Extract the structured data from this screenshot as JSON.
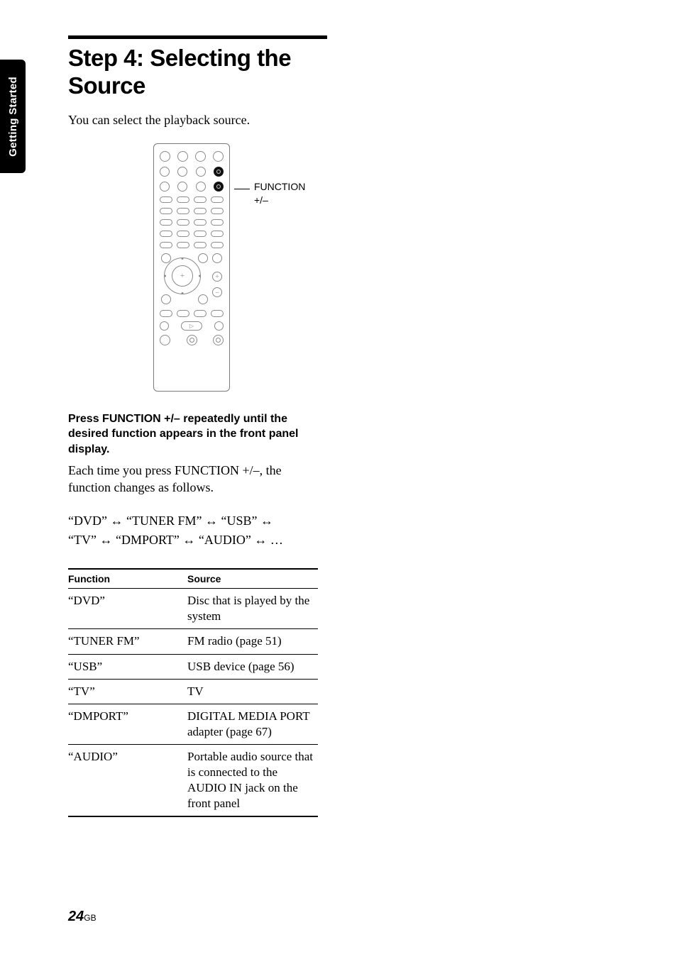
{
  "sidebar": {
    "label": "Getting Started"
  },
  "heading": "Step 4: Selecting the Source",
  "intro": "You can select the playback source.",
  "callout": {
    "line1": "FUNCTION",
    "line2": "+/–"
  },
  "instruction": "Press FUNCTION +/– repeatedly until the desired function appears in the front panel display.",
  "after_instruction": "Each time you press FUNCTION +/–, the function changes as follows.",
  "cycle": {
    "line1_a": "“DVD” ",
    "line1_b": " “TUNER FM” ",
    "line1_c": " “USB” ",
    "line2_a": "“TV” ",
    "line2_b": " “DMPORT” ",
    "line2_c": " “AUDIO” ",
    "line2_d": " …",
    "arrow": "↔"
  },
  "table": {
    "head": {
      "c1": "Function",
      "c2": "Source"
    },
    "rows": [
      {
        "c1": "“DVD”",
        "c2": "Disc that is played by the system"
      },
      {
        "c1": "“TUNER FM”",
        "c2": "FM radio (page 51)"
      },
      {
        "c1": "“USB”",
        "c2": "USB device (page 56)"
      },
      {
        "c1": "“TV”",
        "c2": "TV"
      },
      {
        "c1": "“DMPORT”",
        "c2": "DIGITAL MEDIA PORT adapter (page 67)"
      },
      {
        "c1": "“AUDIO”",
        "c2": "Portable audio source that is connected to the AUDIO IN jack on the front panel"
      }
    ]
  },
  "footer": {
    "page": "24",
    "region": "GB"
  }
}
